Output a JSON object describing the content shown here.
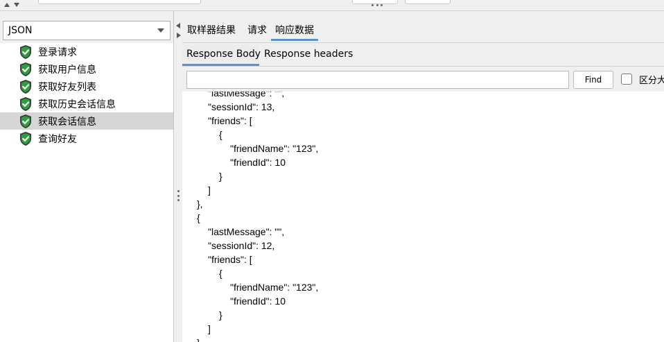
{
  "renderer": {
    "selected": "JSON"
  },
  "tree": {
    "items": [
      {
        "label": "登录请求",
        "icon": "green-shield-check-icon",
        "selected": false
      },
      {
        "label": "获取用户信息",
        "icon": "green-shield-check-icon",
        "selected": false
      },
      {
        "label": "获取好友列表",
        "icon": "green-shield-check-icon",
        "selected": false
      },
      {
        "label": "获取历史会话信息",
        "icon": "green-shield-check-icon",
        "selected": false
      },
      {
        "label": "获取会话信息",
        "icon": "green-shield-check-icon",
        "selected": true
      },
      {
        "label": "查询好友",
        "icon": "green-shield-check-icon",
        "selected": false
      }
    ]
  },
  "result_tabs": [
    {
      "label": "取样器结果",
      "active": false
    },
    {
      "label": "请求",
      "active": false
    },
    {
      "label": "响应数据",
      "active": true
    }
  ],
  "response_tabs": [
    {
      "label": "Response Body",
      "active": true
    },
    {
      "label": "Response headers",
      "active": false
    }
  ],
  "search": {
    "value": "",
    "find_label": "Find",
    "case_label": "区分大"
  },
  "response_body": {
    "lines": [
      {
        "text": "\"lastMessage\": \"\",",
        "indent": 2
      },
      {
        "text": "\"sessionId\": 13,",
        "indent": 2
      },
      {
        "text": "\"friends\": [",
        "indent": 2
      },
      {
        "text": "{",
        "indent": 3
      },
      {
        "text": "\"friendName\": \"123\",",
        "indent": 4
      },
      {
        "text": "\"friendId\": 10",
        "indent": 4
      },
      {
        "text": "}",
        "indent": 3
      },
      {
        "text": "]",
        "indent": 2
      },
      {
        "text": "},",
        "indent": 1
      },
      {
        "text": "{",
        "indent": 1
      },
      {
        "text": "\"lastMessage\": \"\",",
        "indent": 2
      },
      {
        "text": "\"sessionId\": 12,",
        "indent": 2
      },
      {
        "text": "\"friends\": [",
        "indent": 2
      },
      {
        "text": "{",
        "indent": 3
      },
      {
        "text": "\"friendName\": \"123\",",
        "indent": 4
      },
      {
        "text": "\"friendId\": 10",
        "indent": 4
      },
      {
        "text": "}",
        "indent": 3
      },
      {
        "text": "]",
        "indent": 2
      },
      {
        "text": "}",
        "indent": 1
      }
    ]
  },
  "colors": {
    "selection": "#d6d6d6",
    "tab_accent": "#5b8fc7",
    "icon_green": "#2e9e3e"
  }
}
